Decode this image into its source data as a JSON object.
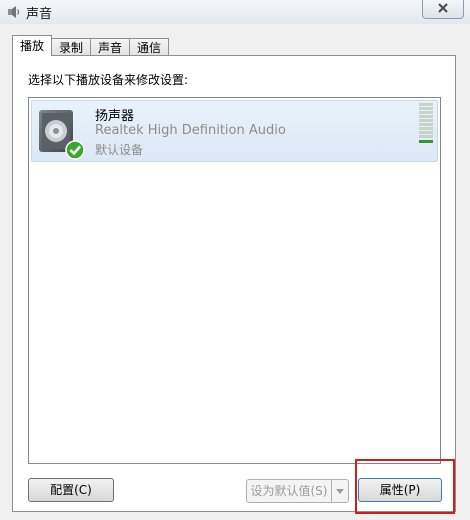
{
  "window": {
    "title": "声音"
  },
  "tabs": [
    {
      "label": "播放",
      "active": true
    },
    {
      "label": "录制",
      "active": false
    },
    {
      "label": "声音",
      "active": false
    },
    {
      "label": "通信",
      "active": false
    }
  ],
  "playback": {
    "instruction": "选择以下播放设备来修改设置:",
    "devices": [
      {
        "name": "扬声器",
        "driver": "Realtek High Definition Audio",
        "status": "默认设备",
        "icon": "speaker-icon",
        "badge": "default-check-icon"
      }
    ]
  },
  "buttons": {
    "configure": "配置(C)",
    "set_default": "设为默认值(S)",
    "properties": "属性(P)"
  },
  "colors": {
    "highlight": "#d51c1c",
    "selection": "#dbe8f6",
    "check": "#3aa82e"
  }
}
